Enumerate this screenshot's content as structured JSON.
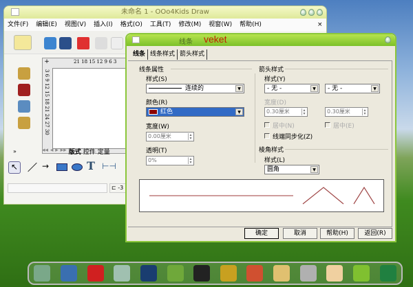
{
  "main_window": {
    "title": "未命名 1 - OOo4Kids Draw",
    "menu": [
      "文件(F)",
      "编辑(E)",
      "视图(V)",
      "插入(I)",
      "格式(O)",
      "工具(T)",
      "修改(M)",
      "视窗(W)",
      "帮助(H)"
    ],
    "close": "×",
    "ruler_h": "21 18 15 12 9  6  3",
    "ruler_v": "3 6 9 12 15 18 21 24 27 30",
    "sheet_tabs": [
      "版式",
      "控件",
      "定量"
    ],
    "status_pos": "-3"
  },
  "dialog": {
    "title": "线条",
    "watermark": "veket",
    "tabs": [
      "线条",
      "线条样式",
      "箭头样式"
    ],
    "line_props": {
      "section": "线条属性",
      "style_label": "样式(S)",
      "style_value": "连续的",
      "color_label": "颜色(R)",
      "color_value": "红色",
      "color_hex": "#8b0000",
      "width_label": "宽度(W)",
      "width_value": "0.00厘米",
      "transparency_label": "透明(T)",
      "transparency_value": "0%"
    },
    "arrow": {
      "section": "箭头样式",
      "style_label": "样式(Y)",
      "start": "- 无 -",
      "end": "- 无 -",
      "width_label": "宽度(D)",
      "start_width": "0.30厘米",
      "end_width": "0.30厘米",
      "center_left": "居中(N)",
      "center_right": "居中(E)",
      "sync": "线端同步化(Z)"
    },
    "corner": {
      "section": "棱角样式",
      "style_label": "样式(L)",
      "value": "圆角"
    },
    "buttons": {
      "ok": "确定",
      "cancel": "取消",
      "help": "帮助(H)",
      "reset": "返回(R)"
    },
    "preview_color": "#b06060"
  },
  "dock_colors": [
    "#7aa889",
    "#3a6fb0",
    "#d02020",
    "#a0c0b0",
    "#1a3d70",
    "#6fa83a",
    "#222222",
    "#c8a020",
    "#d05030",
    "#e0c070",
    "#b0b0b0",
    "#f0d0a0",
    "#80c030",
    "#208040"
  ]
}
